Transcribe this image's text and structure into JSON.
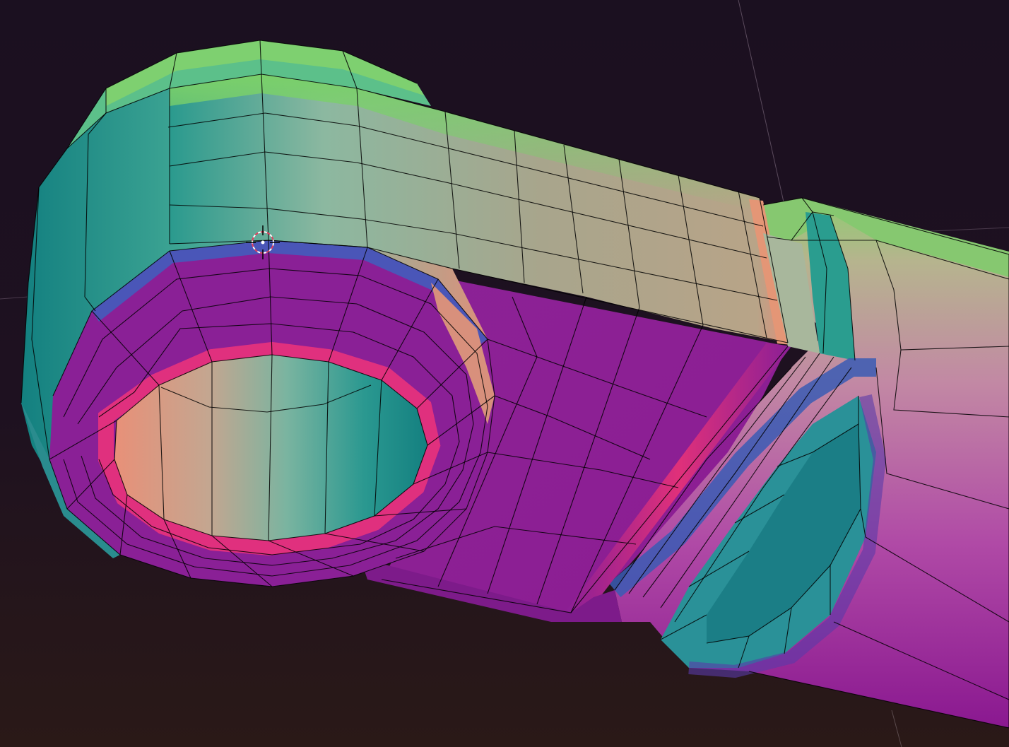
{
  "viewport": {
    "view": "3d-viewport",
    "shading": "normal-map-with-wireframe",
    "colors": {
      "background_top": "#1b1020",
      "background_bottom": "#28171a",
      "teal": "#1d8a8a",
      "mint": "#7ec8a0",
      "beige": "#a8a48c",
      "salmon": "#e0907a",
      "magenta": "#8a1f96",
      "hot_pink": "#d22d8c",
      "blue": "#3a5fb0",
      "green_rim": "#7ad06a",
      "wire": "#000000",
      "cursor": "#ffffff",
      "cursor_ring": "#e04060"
    }
  },
  "cursor": {
    "name": "3d-cursor"
  }
}
